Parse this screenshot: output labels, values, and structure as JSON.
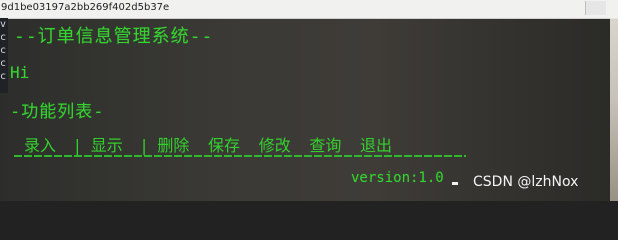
{
  "window": {
    "title": "9d1be03197a2bb269f402d5b37e",
    "left_letters": [
      "v",
      "c",
      "c",
      "c",
      "c"
    ]
  },
  "terminal": {
    "heading": "--订单信息管理系统--",
    "greeting": "Hi",
    "section_title": "-功能列表-",
    "menu": {
      "items": [
        "录入",
        "显示",
        "删除",
        "保存",
        "修改",
        "查询",
        "退出"
      ],
      "separators": [
        "|",
        "|"
      ]
    },
    "version": "version:1.0"
  },
  "watermark": "CSDN @lzhNox",
  "colors": {
    "terminal_text": "#35d32f",
    "background": "#3a3935"
  }
}
